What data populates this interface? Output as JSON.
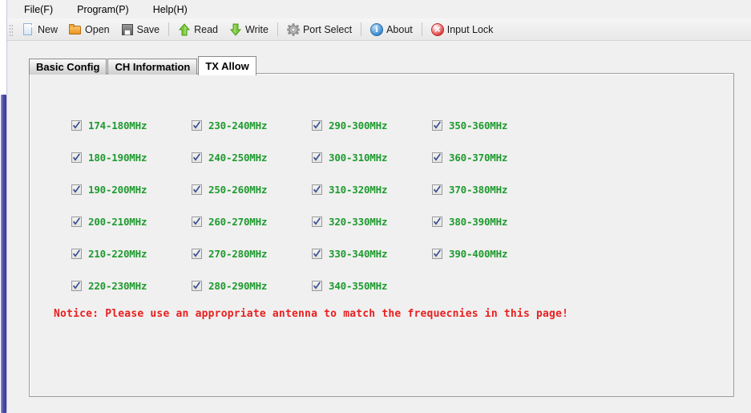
{
  "window": {
    "background_color": "#f0f0f0",
    "scrollbar": {
      "name": "vertical-scrollbar",
      "thumb_color": "#4a4aa8"
    }
  },
  "menubar": {
    "items": [
      {
        "label": "File(F)",
        "name": "menu-file"
      },
      {
        "label": "Program(P)",
        "name": "menu-program"
      },
      {
        "label": "Help(H)",
        "name": "menu-help"
      }
    ]
  },
  "toolbar": {
    "buttons": [
      {
        "label": "New",
        "icon": "new-page-icon"
      },
      {
        "label": "Open",
        "icon": "open-folder-icon"
      },
      {
        "label": "Save",
        "icon": "save-floppy-icon"
      },
      {
        "label": "Read",
        "icon": "arrow-up-icon"
      },
      {
        "label": "Write",
        "icon": "arrow-down-icon"
      },
      {
        "label": "Port Select",
        "icon": "gear-icon"
      },
      {
        "label": "About",
        "icon": "info-icon"
      },
      {
        "label": "Input Lock",
        "icon": "lock-error-icon"
      }
    ]
  },
  "tabs": [
    {
      "label": "Basic Config",
      "active": false
    },
    {
      "label": "CH Information",
      "active": false
    },
    {
      "label": "TX Allow",
      "active": true
    }
  ],
  "tx_allow": {
    "label_color": "#1f9a2f",
    "checkbox_checked_color": "#3b4f8f",
    "items": [
      {
        "label": "174-180MHz",
        "checked": true
      },
      {
        "label": "230-240MHz",
        "checked": true
      },
      {
        "label": "290-300MHz",
        "checked": true
      },
      {
        "label": "350-360MHz",
        "checked": true
      },
      {
        "label": "180-190MHz",
        "checked": true
      },
      {
        "label": "240-250MHz",
        "checked": true
      },
      {
        "label": "300-310MHz",
        "checked": true
      },
      {
        "label": "360-370MHz",
        "checked": true
      },
      {
        "label": "190-200MHz",
        "checked": true
      },
      {
        "label": "250-260MHz",
        "checked": true
      },
      {
        "label": "310-320MHz",
        "checked": true
      },
      {
        "label": "370-380MHz",
        "checked": true
      },
      {
        "label": "200-210MHz",
        "checked": true
      },
      {
        "label": "260-270MHz",
        "checked": true
      },
      {
        "label": "320-330MHz",
        "checked": true
      },
      {
        "label": "380-390MHz",
        "checked": true
      },
      {
        "label": "210-220MHz",
        "checked": true
      },
      {
        "label": "270-280MHz",
        "checked": true
      },
      {
        "label": "330-340MHz",
        "checked": true
      },
      {
        "label": "390-400MHz",
        "checked": true
      },
      {
        "label": "220-230MHz",
        "checked": true
      },
      {
        "label": "280-290MHz",
        "checked": true
      },
      {
        "label": "340-350MHz",
        "checked": true
      },
      {
        "label": "",
        "checked": false,
        "empty": true
      }
    ],
    "notice": {
      "text": "Notice: Please use an appropriate antenna to match the frequecnies in this page!",
      "color": "#e8201f"
    }
  }
}
